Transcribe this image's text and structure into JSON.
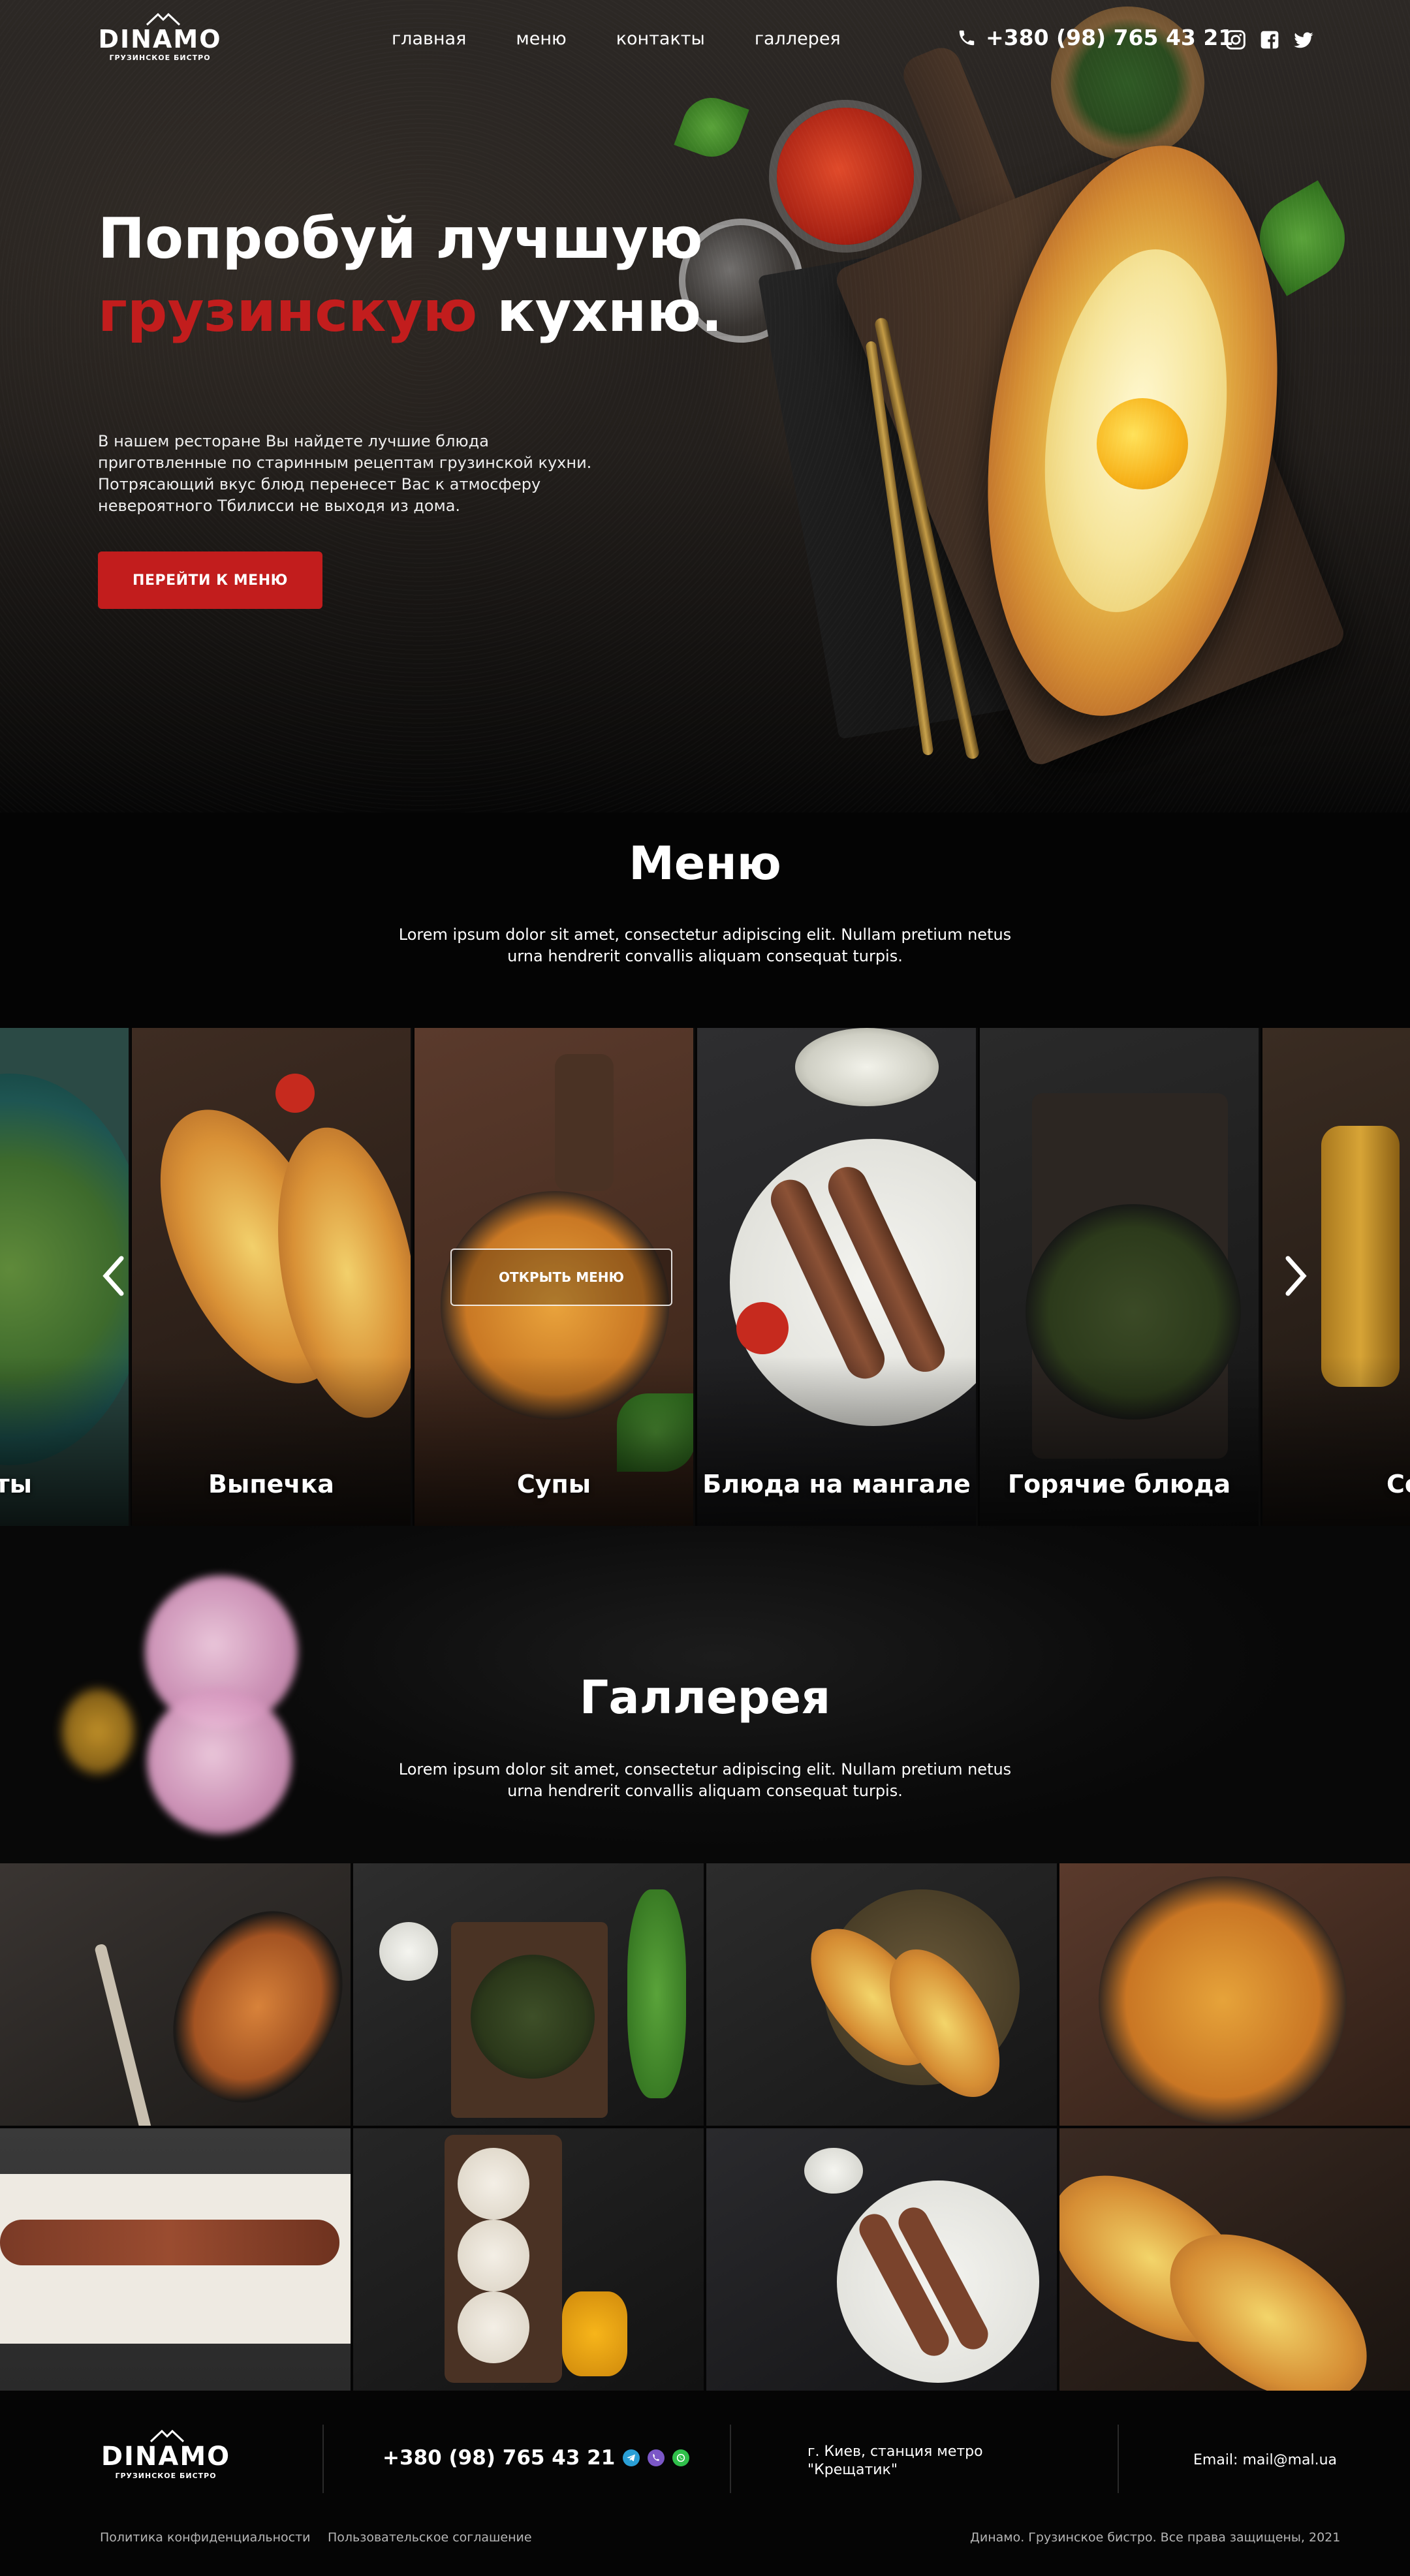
{
  "header": {
    "logo_text": "DINAMO",
    "logo_subtitle": "ГРУЗИНСКОЕ БИСТРО",
    "nav": [
      "главная",
      "меню",
      "контакты",
      "галлерея"
    ],
    "phone": "+380 (98) 765 43 21",
    "icons": [
      "phone-icon",
      "instagram-icon",
      "facebook-icon",
      "twitter-icon"
    ]
  },
  "hero": {
    "title_line1": "Попробуй лучшую",
    "title_red": "грузинскую",
    "title_rest": " кухню.",
    "text": "В нашем ресторане Вы найдете лучшие блюда приготвленные по старинным рецептам грузинской кухни. Потрясающий вкус блюд перенесет Вас к атмосферу невероятного Тбилисси не выходя из дома.",
    "button": "ПЕРЕЙТИ К МЕНЮ"
  },
  "menu": {
    "title": "Меню",
    "subtitle": "Lorem ipsum dolor sit amet, consectetur adipiscing elit. Nullam pretium netus urna hendrerit convallis aliquam consequat turpis.",
    "open_button": "ОТКРЫТЬ МЕНЮ",
    "cards": [
      "ты",
      "Выпечка",
      "Супы",
      "Блюда на мангале",
      "Горячие блюда",
      "Со"
    ],
    "icons": [
      "chevron-left-icon",
      "chevron-right-icon"
    ]
  },
  "gallery": {
    "title": "Галлерея",
    "subtitle": "Lorem ipsum dolor sit amet, consectetur adipiscing elit. Nullam pretium netus urna hendrerit convallis aliquam consequat turpis."
  },
  "footer": {
    "logo_text": "DINAMO",
    "logo_subtitle": "ГРУЗИНСКОЕ БИСТРО",
    "phone": "+380 (98) 765 43 21",
    "address_line1": "г. Киев, станция метро",
    "address_line2": "\"Крещатик\"",
    "email": "Email: mail@mal.ua",
    "privacy": "Политика конфиденциальности",
    "terms": "Пользовательское соглашение",
    "copyright": "Динамо. Грузинское бистро. Все права защищены, 2021",
    "icons": [
      "telegram-icon",
      "viber-icon",
      "whatsapp-icon"
    ]
  },
  "colors": {
    "accent": "#c21d1d",
    "background": "#060606",
    "text": "#ffffff"
  }
}
